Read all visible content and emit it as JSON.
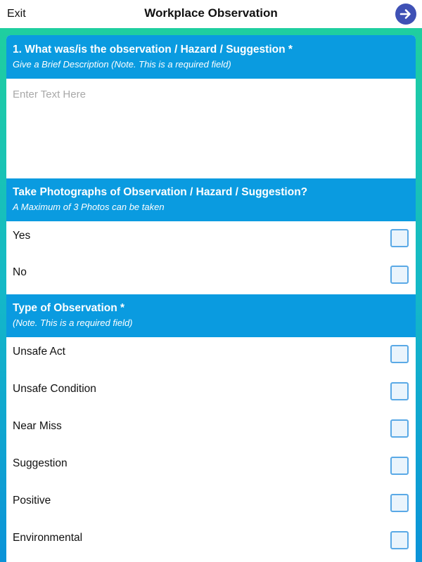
{
  "header": {
    "exit_label": "Exit",
    "title": "Workplace Observation",
    "next_icon": "arrow-right-circle-icon"
  },
  "colors": {
    "accent": "#0a9be0",
    "next_button": "#3f51b5",
    "checkbox_border": "#5aa9e6",
    "gradient_top": "#1fcf9f",
    "gradient_bottom": "#0b93d8"
  },
  "observation": {
    "title": "1. What was/is the observation / Hazard / Suggestion *",
    "subtitle": "Give a Brief Description (Note. This is a required field)",
    "placeholder": "Enter Text Here",
    "value": ""
  },
  "photos": {
    "title": "Take Photographs of Observation / Hazard / Suggestion?",
    "subtitle": "A Maximum of 3 Photos can be taken",
    "options": [
      {
        "label": "Yes",
        "checked": false
      },
      {
        "label": "No",
        "checked": false
      }
    ]
  },
  "type": {
    "title": "Type of Observation *",
    "subtitle": "(Note. This is a required field)",
    "options": [
      {
        "label": "Unsafe Act",
        "checked": false
      },
      {
        "label": "Unsafe Condition",
        "checked": false
      },
      {
        "label": "Near Miss",
        "checked": false
      },
      {
        "label": "Suggestion",
        "checked": false
      },
      {
        "label": "Positive",
        "checked": false
      },
      {
        "label": "Environmental",
        "checked": false
      }
    ]
  }
}
